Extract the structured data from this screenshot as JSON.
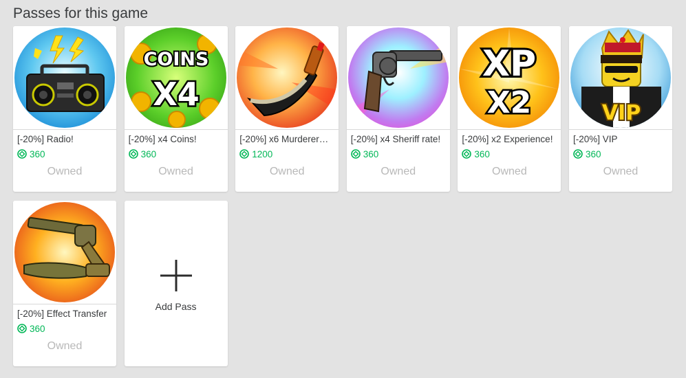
{
  "section": {
    "title": "Passes for this game"
  },
  "passes": [
    {
      "name": "[-20%] Radio!",
      "price": "360",
      "status": "Owned",
      "icon": "boombox-radio-icon"
    },
    {
      "name": "[-20%] x4 Coins!",
      "price": "360",
      "status": "Owned",
      "icon": "coins-x4-icon",
      "art_text": [
        "COINS",
        "X4"
      ]
    },
    {
      "name": "[-20%] x6 Murderer…",
      "price": "1200",
      "status": "Owned",
      "icon": "knife-icon"
    },
    {
      "name": "[-20%] x4 Sheriff rate!",
      "price": "360",
      "status": "Owned",
      "icon": "revolver-icon"
    },
    {
      "name": "[-20%] x2 Experience!",
      "price": "360",
      "status": "Owned",
      "icon": "xp-x2-icon",
      "art_text": [
        "XP",
        "X2"
      ]
    },
    {
      "name": "[-20%] VIP",
      "price": "360",
      "status": "Owned",
      "icon": "vip-avatar-icon",
      "art_text": [
        "VIP"
      ]
    },
    {
      "name": "[-20%] Effect Transfer",
      "price": "360",
      "status": "Owned",
      "icon": "gun-and-knife-icon"
    }
  ],
  "add_pass": {
    "label": "Add Pass",
    "icon": "plus-icon"
  },
  "colors": {
    "price_green": "#02b757",
    "owned_gray": "#b8b8b8",
    "background": "#e3e3e3"
  }
}
